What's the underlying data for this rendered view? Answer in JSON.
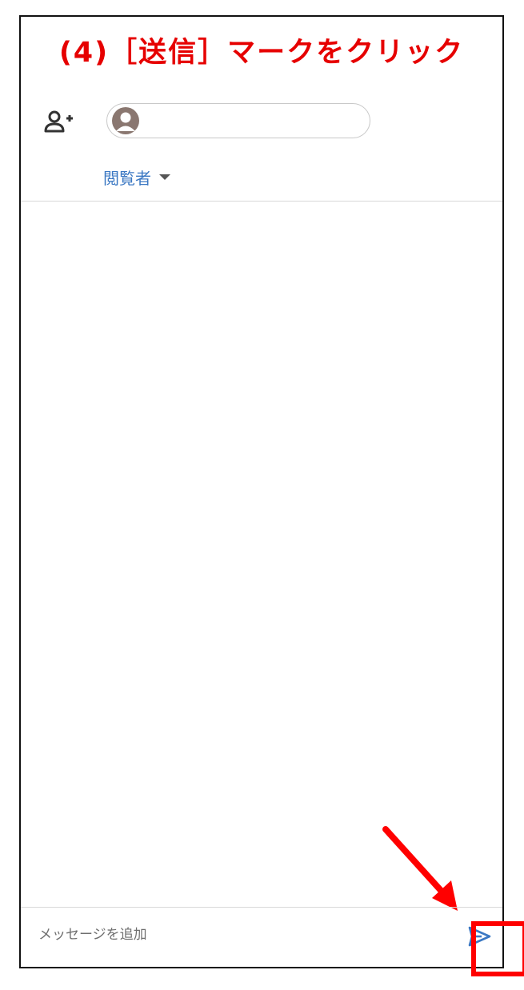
{
  "instruction": {
    "text": "(4)［送信］マークをクリック",
    "color": "#e60000"
  },
  "share_dialog": {
    "add_person_icon": "person-add-icon",
    "recipient_placeholder": "",
    "avatar_icon": "account-circle-icon",
    "role": {
      "label": "閲覧者",
      "dropdown_icon": "caret-down-icon"
    }
  },
  "composer": {
    "message_placeholder": "メッセージを追加",
    "send_icon": "send-icon",
    "accent_color": "#3b78c3"
  },
  "annotations": {
    "highlight_color": "#ff0000",
    "arrow_color": "#ff0000"
  }
}
